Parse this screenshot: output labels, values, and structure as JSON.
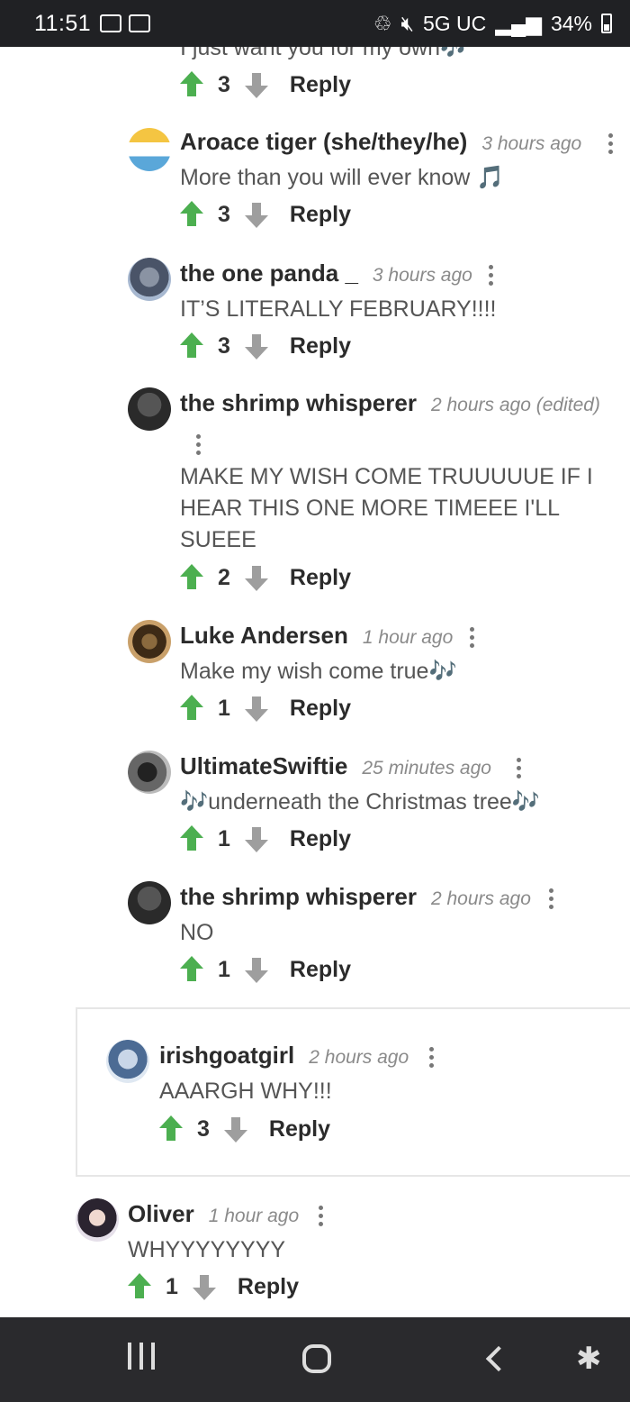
{
  "status_bar": {
    "time": "11:51",
    "network": "5G UC",
    "battery": "34%"
  },
  "comments": [
    {
      "body": "I just want you for my own",
      "emoji": "🎶",
      "score": "3",
      "reply_label": "Reply"
    },
    {
      "author": "Aroace tiger (she/they/he)",
      "time": "3 hours ago",
      "body": "More than you will ever know",
      "emoji": "🎵",
      "score": "3",
      "reply_label": "Reply"
    },
    {
      "author": "the one panda _",
      "time": "3 hours ago",
      "body": "IT’S LITERALLY FEBRUARY!!!!",
      "score": "3",
      "reply_label": "Reply"
    },
    {
      "author": "the shrimp whisperer",
      "time": "2 hours ago (edited)",
      "body_lines": [
        "MAKE MY WISH COME TRUUUUUE IF I",
        "HEAR THIS ONE MORE TIMEEE I'LL",
        "SUEEE"
      ],
      "score": "2",
      "reply_label": "Reply"
    },
    {
      "author": "Luke Andersen",
      "time": "1 hour ago",
      "body": "Make my wish come true",
      "emoji": "🎶",
      "score": "1",
      "reply_label": "Reply"
    },
    {
      "author": "UltimateSwiftie",
      "time": "25 minutes ago",
      "body": "underneath the Christmas tree",
      "emoji": "🎶",
      "score": "1",
      "reply_label": "Reply"
    },
    {
      "author": "the shrimp whisperer",
      "time": "2 hours ago",
      "body": "NO",
      "score": "1",
      "reply_label": "Reply"
    },
    {
      "author": "irishgoatgirl",
      "time": "2 hours ago",
      "body": "AAARGH WHY!!!",
      "score": "3",
      "reply_label": "Reply"
    },
    {
      "author": "Oliver",
      "time": "1 hour ago",
      "body": "WHYYYYYYYY",
      "score": "1",
      "reply_label": "Reply"
    }
  ],
  "icons": {
    "upvote": "arrow-up-icon",
    "downvote": "arrow-down-icon",
    "more": "more-vertical-icon",
    "upvote_color": "#4caf50",
    "downvote_color": "#9e9e9e"
  }
}
